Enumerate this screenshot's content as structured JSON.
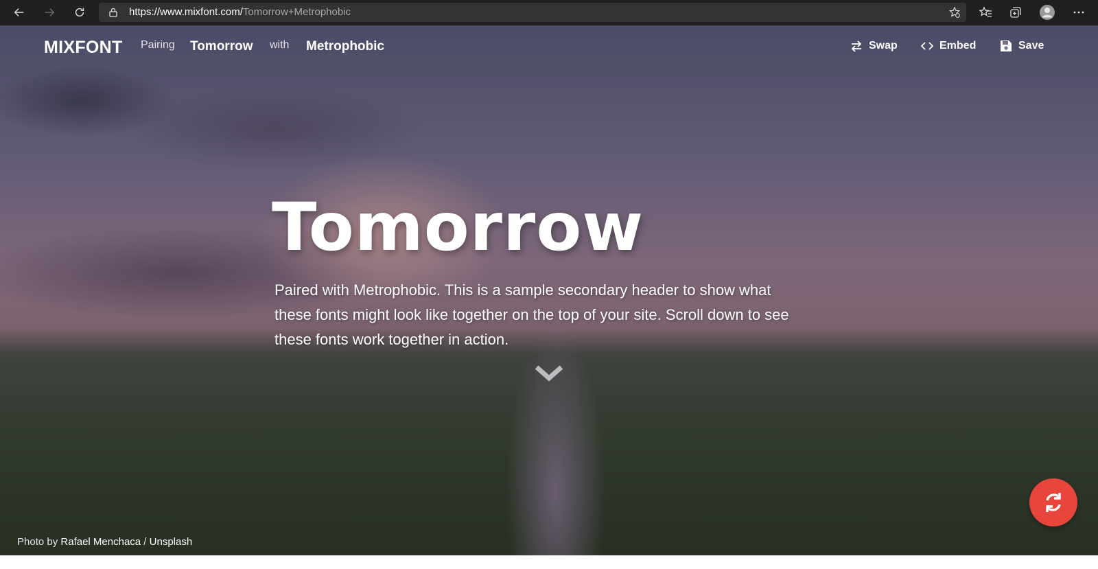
{
  "browser": {
    "url_host": "https://www.mixfont.com/",
    "url_path": "Tomorrow+Metrophobic",
    "icons": [
      "back-icon",
      "forward-icon",
      "refresh-icon",
      "lock-icon",
      "add-favorite-icon",
      "favorites-icon",
      "collections-icon",
      "profile-icon",
      "more-icon"
    ]
  },
  "header": {
    "logo": "MIXFONT",
    "pairing_label": "Pairing",
    "font_primary": "Tomorrow",
    "with_label": "with",
    "font_secondary": "Metrophobic",
    "actions": {
      "swap": "Swap",
      "embed": "Embed",
      "save": "Save"
    }
  },
  "hero": {
    "title": "Tomorrow",
    "subtitle": "Paired with Metrophobic. This is a sample secondary header to show what these fonts might look like together on the top of your site. Scroll down to see these fonts work together in action."
  },
  "credit": {
    "prefix": "Photo by ",
    "author": "Rafael Menchaca",
    "separator": " / ",
    "source": "Unsplash"
  },
  "colors": {
    "accent": "#e8453c",
    "browser_bar": "#202020",
    "address_bar": "#333333"
  }
}
